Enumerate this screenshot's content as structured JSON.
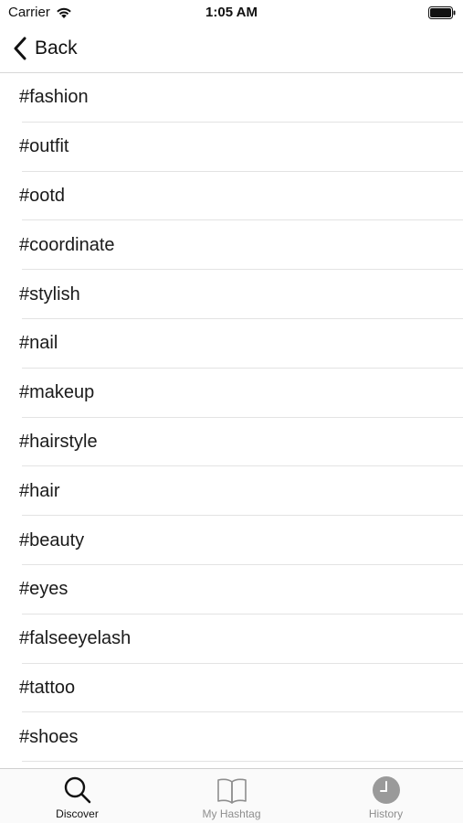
{
  "status_bar": {
    "carrier": "Carrier",
    "time": "1:05 AM"
  },
  "nav": {
    "back_label": "Back"
  },
  "hashtags": [
    "#fashion",
    "#outfit",
    "#ootd",
    "#coordinate",
    "#stylish",
    "#nail",
    "#makeup",
    "#hairstyle",
    "#hair",
    "#beauty",
    "#eyes",
    "#falseeyelash",
    "#tattoo",
    "#shoes"
  ],
  "tab_bar": {
    "tabs": [
      {
        "label": "Discover",
        "icon": "search-icon",
        "active": true
      },
      {
        "label": "My Hashtag",
        "icon": "book-icon",
        "active": false
      },
      {
        "label": "History",
        "icon": "clock-icon",
        "active": false
      }
    ]
  },
  "colors": {
    "active": "#111111",
    "inactive": "#8e8e8e",
    "separator": "#e3e3e3"
  }
}
